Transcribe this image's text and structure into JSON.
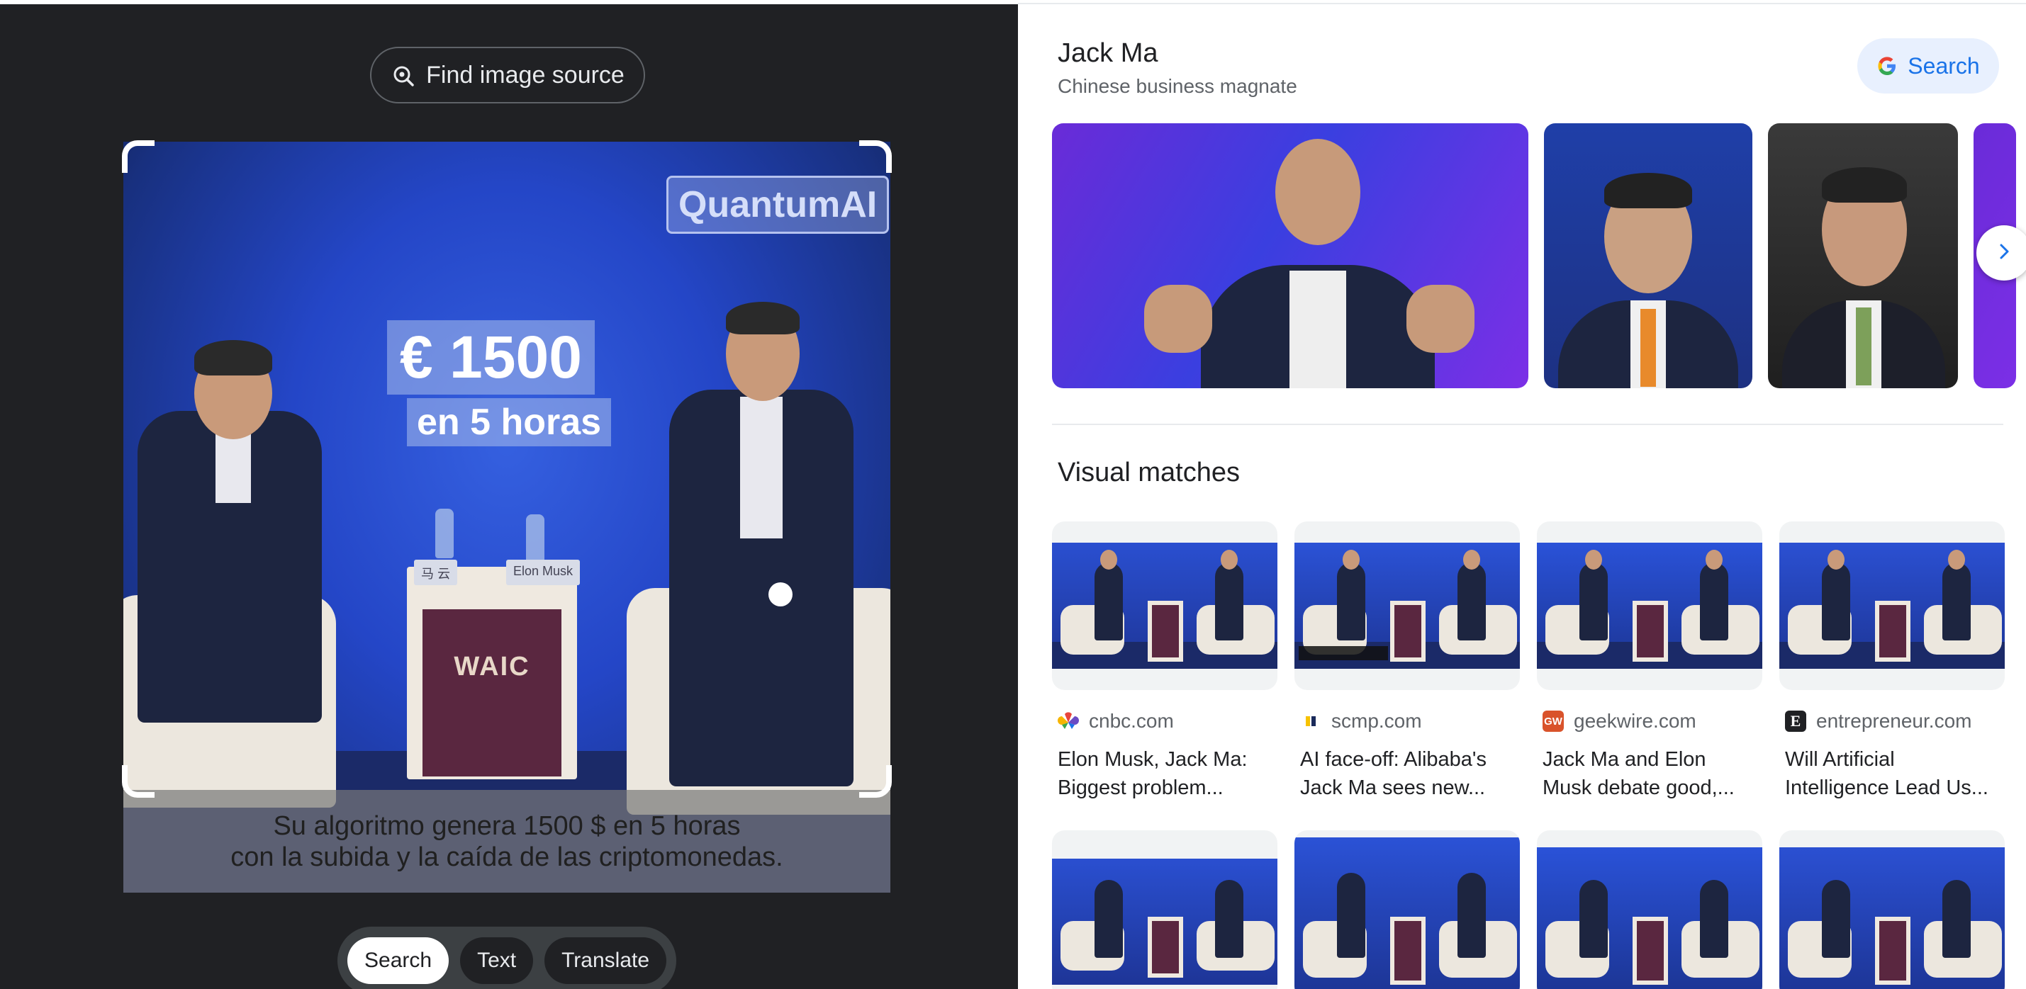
{
  "left": {
    "find_source_label": "Find image source",
    "image": {
      "watermark": "QuantumAI",
      "overlay_amount": "€ 1500",
      "overlay_hours": "en 5 horas",
      "nameplate_left": "马 云",
      "nameplate_right": "Elon Musk",
      "podium_logo": "WAIC",
      "subtitle_line1": "Su algoritmo genera 1500 $ en 5 horas",
      "subtitle_line2": "con la subida y la caída de las criptomonedas."
    },
    "modes": [
      {
        "label": "Search",
        "active": true
      },
      {
        "label": "Text",
        "active": false
      },
      {
        "label": "Translate",
        "active": false
      }
    ]
  },
  "right": {
    "entity": {
      "title": "Jack Ma",
      "subtitle": "Chinese business magnate",
      "search_label": "Search"
    },
    "visual_matches_heading": "Visual matches",
    "matches": [
      {
        "source": "cnbc.com",
        "favicon": "cnbc-icon",
        "title_line1": "Elon Musk, Jack Ma:",
        "title_line2": "Biggest problem..."
      },
      {
        "source": "scmp.com",
        "favicon": "scmp-icon",
        "title_line1": "AI face-off: Alibaba's",
        "title_line2": "Jack Ma sees new..."
      },
      {
        "source": "geekwire.com",
        "favicon": "geekwire-icon",
        "favicon_text": "GW",
        "title_line1": "Jack Ma and Elon",
        "title_line2": "Musk debate good,..."
      },
      {
        "source": "entrepreneur.com",
        "favicon": "entrepreneur-icon",
        "favicon_text": "E",
        "title_line1": "Will Artificial",
        "title_line2": "Intelligence Lead Us..."
      }
    ]
  },
  "colors": {
    "dark_bg": "#202124",
    "accent_blue": "#1a73e8",
    "search_chip_bg": "#e8f0fe",
    "stage_blue": "#2446c7"
  }
}
